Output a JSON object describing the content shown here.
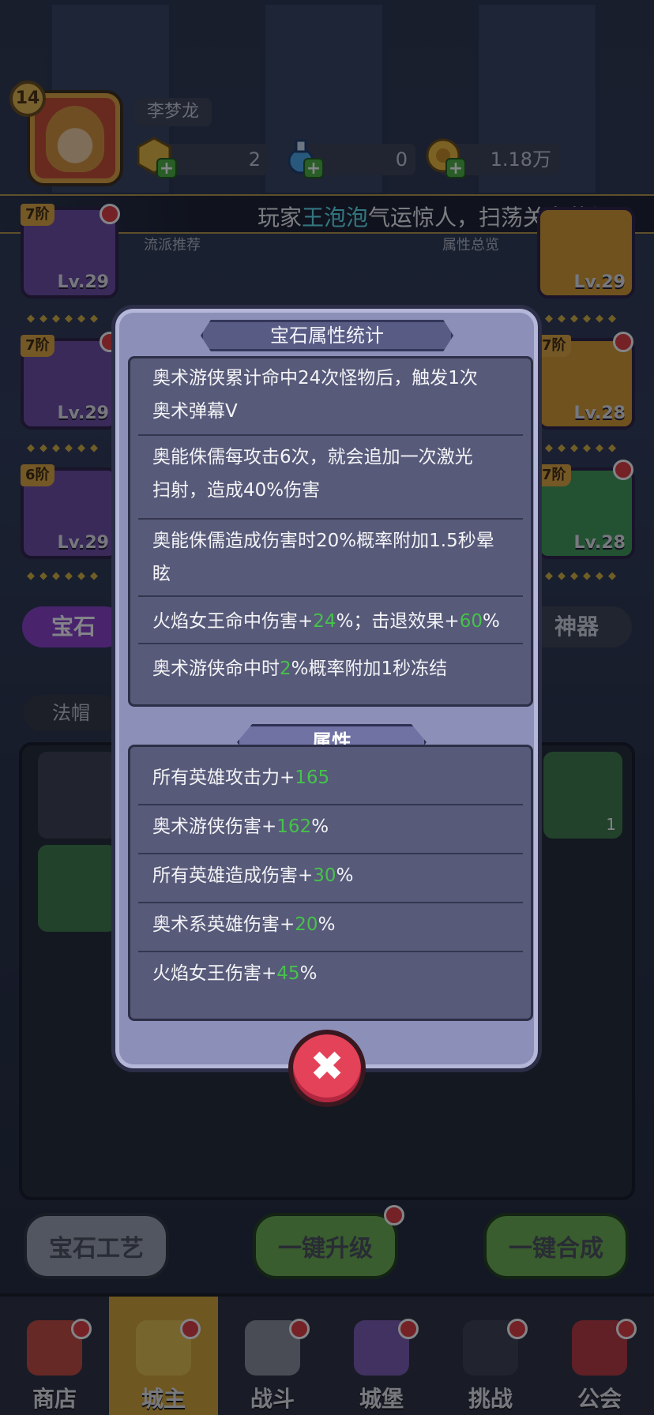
{
  "header": {
    "level": "14",
    "player_name": "李梦龙",
    "resources": [
      {
        "icon": "gold-hexagon-icon",
        "value": "2"
      },
      {
        "icon": "potion-bottle-icon",
        "value": "0"
      },
      {
        "icon": "coin-icon",
        "value": "1.18万"
      }
    ]
  },
  "ticker": {
    "prefix": "玩家",
    "highlight": "王泡泡",
    "suffix": "气运惊人，扫荡关卡获得"
  },
  "quick_links": {
    "left": "流派推荐",
    "right": "属性总览"
  },
  "equipment": [
    {
      "rank": "7阶",
      "level": "Lv.29"
    },
    {
      "rank": "",
      "level": "Lv.29"
    },
    {
      "rank": "7阶",
      "level": "Lv.29"
    },
    {
      "rank": "7阶",
      "level": "Lv.28"
    },
    {
      "rank": "6阶",
      "level": "Lv.29"
    },
    {
      "rank": "7阶",
      "level": "Lv.28"
    }
  ],
  "tabs": {
    "gem": "宝石",
    "artifact": "神器"
  },
  "filter": "法帽",
  "gem_count": "1",
  "bottom_buttons": {
    "craft": "宝石工艺",
    "upgrade": "一键升级",
    "merge": "一键合成"
  },
  "nav": [
    {
      "label": "商店",
      "icon": "shop-icon"
    },
    {
      "label": "城主",
      "icon": "crown-icon"
    },
    {
      "label": "战斗",
      "icon": "swords-icon"
    },
    {
      "label": "城堡",
      "icon": "castle-icon"
    },
    {
      "label": "挑战",
      "icon": "demon-icon"
    },
    {
      "label": "公会",
      "icon": "guild-book-icon"
    }
  ],
  "modal": {
    "title": "宝石属性统计",
    "effects": [
      {
        "line1": "奥术游侠累计命中24次怪物后，触发1次",
        "line2": "奥术弹幕V"
      },
      {
        "line1": "奥能侏儒每攻击6次，就会追加一次激光",
        "line2": "扫射，造成40%伤害"
      },
      {
        "line1": "奥能侏儒造成伤害时20%概率附加1.5秒晕",
        "line2": "眩"
      },
      {
        "pre": "火焰女王命中伤害+",
        "v1": "24",
        "mid": "%；击退效果+",
        "v2": "60",
        "post": "%"
      },
      {
        "pre": "奥术游侠命中时",
        "v1": "2",
        "post": "%概率附加1秒冻结"
      }
    ],
    "section_title": "属性",
    "attributes": [
      {
        "label": "所有英雄攻击力+",
        "value": "165",
        "unit": ""
      },
      {
        "label": "奥术游侠伤害+",
        "value": "162",
        "unit": "%"
      },
      {
        "label": "所有英雄造成伤害+",
        "value": "30",
        "unit": "%"
      },
      {
        "label": "奥术系英雄伤害+",
        "value": "20",
        "unit": "%"
      },
      {
        "label": "火焰女王伤害+",
        "value": "45",
        "unit": "%"
      }
    ],
    "close_symbol": "✖"
  }
}
